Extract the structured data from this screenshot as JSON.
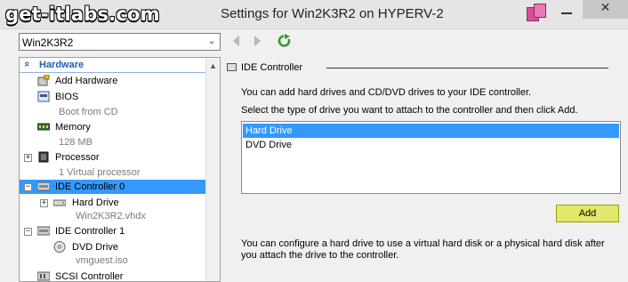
{
  "watermark": "get-itlabs.com",
  "window": {
    "title": "Settings for Win2K3R2 on HYPERV-2",
    "close_glyph": "✕"
  },
  "toolbar": {
    "vm_selected": "Win2K3R2",
    "dropdown_glyph": "⌄"
  },
  "tree": {
    "header": "Hardware",
    "header_glyph": "«",
    "items": [
      {
        "label": "Add Hardware",
        "sub": "",
        "icon": "add-hardware-icon"
      },
      {
        "label": "BIOS",
        "sub": "Boot from CD",
        "icon": "bios-icon"
      },
      {
        "label": "Memory",
        "sub": "128 MB",
        "icon": "memory-icon"
      },
      {
        "label": "Processor",
        "sub": "1 Virtual processor",
        "icon": "processor-icon",
        "expander": "+"
      },
      {
        "label": "IDE Controller 0",
        "sub": "",
        "icon": "ide-controller-icon",
        "expander": "−",
        "selected": true
      },
      {
        "label": "Hard Drive",
        "sub": "Win2K3R2.vhdx",
        "icon": "hard-drive-icon",
        "expander": "+"
      },
      {
        "label": "IDE Controller 1",
        "sub": "",
        "icon": "ide-controller-icon",
        "expander": "−"
      },
      {
        "label": "DVD Drive",
        "sub": "vmguest.iso",
        "icon": "dvd-drive-icon"
      },
      {
        "label": "SCSI Controller",
        "sub": "",
        "icon": "scsi-controller-icon"
      }
    ]
  },
  "panel": {
    "title": "IDE Controller",
    "intro": "You can add hard drives and CD/DVD drives to your IDE controller.",
    "instruction": "Select the type of drive you want to attach to the controller and then click Add.",
    "drive_types": [
      "Hard Drive",
      "DVD Drive"
    ],
    "selected_drive": "Hard Drive",
    "add_label": "Add",
    "footer_line1": "You can configure a hard drive to use a virtual hard disk or a physical hard disk after",
    "footer_line2": "you attach the drive to the controller."
  },
  "colors": {
    "selection": "#3399ff",
    "add_highlight": "#e1e86a",
    "header_blue": "#1e5fb4"
  }
}
